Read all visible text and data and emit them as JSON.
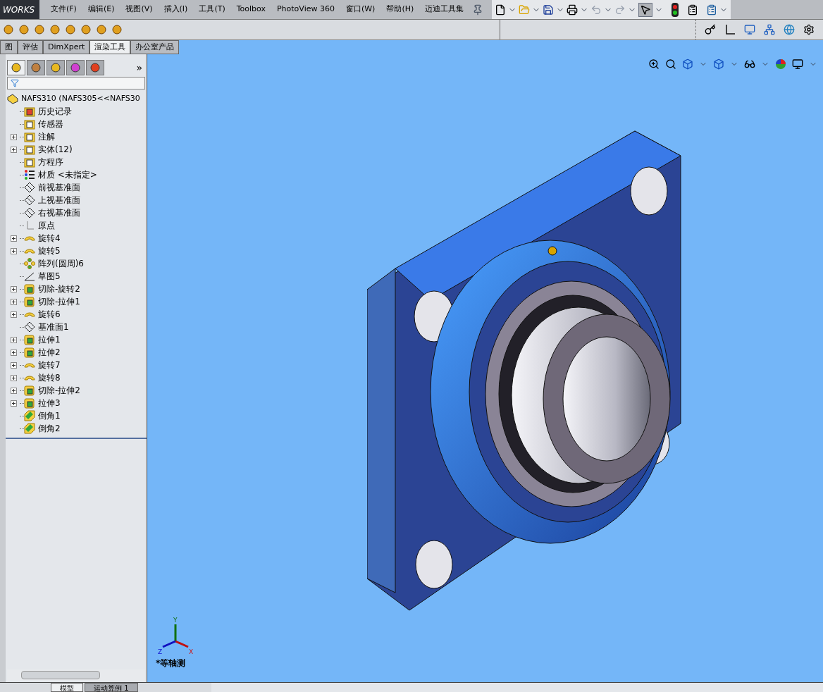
{
  "menu_bar": {
    "logo": "WORKS",
    "items": [
      "文件(F)",
      "编辑(E)",
      "视图(V)",
      "插入(I)",
      "工具(T)",
      "Toolbox",
      "PhotoView 360",
      "窗口(W)",
      "帮助(H)",
      "迈迪工具集"
    ]
  },
  "command_tabs": [
    {
      "label": "图",
      "selected": false
    },
    {
      "label": "评估",
      "selected": false
    },
    {
      "label": "DimXpert",
      "selected": false
    },
    {
      "label": "渲染工具",
      "selected": true
    },
    {
      "label": "办公室产品",
      "selected": false
    }
  ],
  "panel_tabs": [
    {
      "kind": "feature",
      "selected": true
    },
    {
      "kind": "property",
      "selected": false
    },
    {
      "kind": "config",
      "selected": false
    },
    {
      "kind": "target",
      "selected": false
    },
    {
      "kind": "display",
      "selected": false
    }
  ],
  "panel_more": "»",
  "tree": {
    "root": "NAFS310  (NAFS305<<NAFS30",
    "items": [
      {
        "label": "历史记录",
        "kind": "history",
        "expandable": false
      },
      {
        "label": "传感器",
        "kind": "sensor",
        "expandable": false
      },
      {
        "label": "注解",
        "kind": "annotation",
        "expandable": true
      },
      {
        "label": "实体(12)",
        "kind": "solid",
        "expandable": true
      },
      {
        "label": "方程序",
        "kind": "equation",
        "expandable": false
      },
      {
        "label": "材质 <未指定>",
        "kind": "material",
        "expandable": false
      },
      {
        "label": "前视基准面",
        "kind": "plane",
        "expandable": false
      },
      {
        "label": "上视基准面",
        "kind": "plane",
        "expandable": false
      },
      {
        "label": "右视基准面",
        "kind": "plane",
        "expandable": false
      },
      {
        "label": "原点",
        "kind": "origin",
        "expandable": false
      },
      {
        "label": "旋转4",
        "kind": "revolve",
        "expandable": true
      },
      {
        "label": "旋转5",
        "kind": "revolve",
        "expandable": true
      },
      {
        "label": "阵列(圆周)6",
        "kind": "pattern",
        "expandable": false
      },
      {
        "label": "草图5",
        "kind": "sketch",
        "expandable": false
      },
      {
        "label": "切除-旋转2",
        "kind": "cut-revolve",
        "expandable": true
      },
      {
        "label": "切除-拉伸1",
        "kind": "cut-extrude",
        "expandable": true
      },
      {
        "label": "旋转6",
        "kind": "revolve",
        "expandable": true
      },
      {
        "label": "基准面1",
        "kind": "plane",
        "expandable": false
      },
      {
        "label": "拉伸1",
        "kind": "extrude",
        "expandable": true
      },
      {
        "label": "拉伸2",
        "kind": "extrude",
        "expandable": true
      },
      {
        "label": "旋转7",
        "kind": "revolve",
        "expandable": true
      },
      {
        "label": "旋转8",
        "kind": "revolve",
        "expandable": true
      },
      {
        "label": "切除-拉伸2",
        "kind": "cut-extrude",
        "expandable": true
      },
      {
        "label": "拉伸3",
        "kind": "extrude",
        "expandable": true
      },
      {
        "label": "倒角1",
        "kind": "chamfer",
        "expandable": false
      },
      {
        "label": "倒角2",
        "kind": "chamfer",
        "expandable": false
      }
    ]
  },
  "triad": {
    "y": "Y",
    "x": "X",
    "z": "Z"
  },
  "view_label": "*等轴测",
  "bottom_tabs": [
    {
      "label": "模型",
      "selected": true
    },
    {
      "label": "运动算例 1",
      "selected": false
    }
  ]
}
